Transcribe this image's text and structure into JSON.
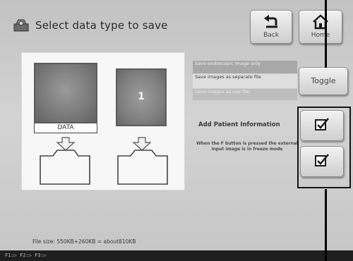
{
  "header": {
    "title": "Select data type to save",
    "back_label": "Back",
    "home_label": "Home"
  },
  "preview": {
    "data_label": "DATA",
    "image_number": "1"
  },
  "save_options": [
    {
      "label": "Save endoscopic image only"
    },
    {
      "label": "Save images as separate file"
    },
    {
      "label": "Save images as one file"
    }
  ],
  "toggle_label": "Toggle",
  "patient_info": {
    "label": "Add Patient Information",
    "note": "When the F button is pressed the external input image is in freeze mode"
  },
  "checkboxes": {
    "add_patient_info_checked": true,
    "freeze_note_checked": true
  },
  "file_size": "File size: 550KB+260KB = about810KB",
  "status_bar": "F1:▷ F2:▷ F3:▷",
  "icons": {
    "header": "camera-folder-icon",
    "back": "back-arrow-icon",
    "home": "home-icon",
    "check": "checkbox-checked-icon",
    "folder": "folder-icon",
    "arrow": "down-arrow-icon"
  }
}
